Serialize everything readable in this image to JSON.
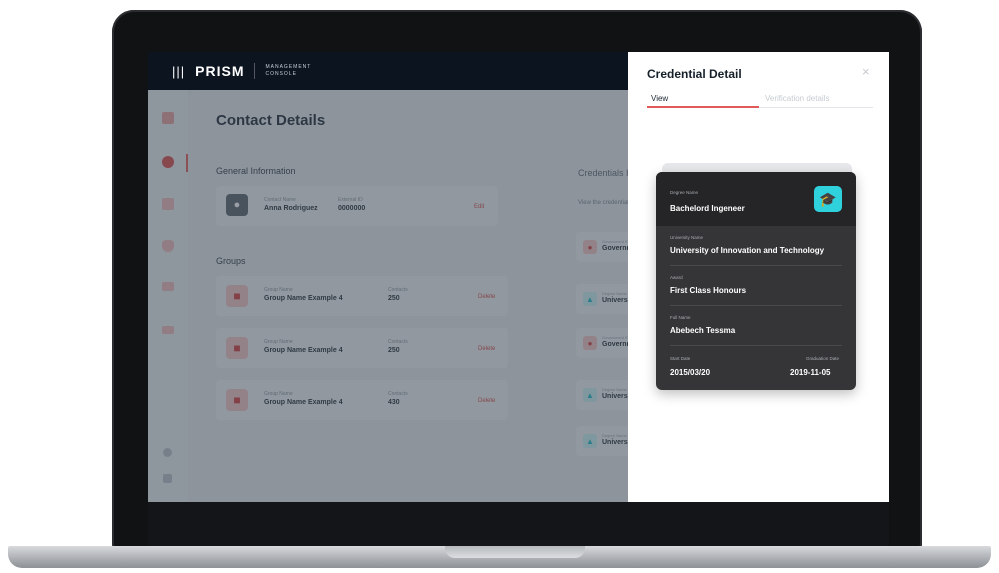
{
  "logo": {
    "mark": "|||",
    "name": "PRISM",
    "sub_line1": "MANAGEMENT",
    "sub_line2": "CONSOLE"
  },
  "page": {
    "title": "Contact Details"
  },
  "general": {
    "section": "General Information",
    "contact_name_label": "Contact Name",
    "contact_name": "Anna Rodriguez",
    "external_id_label": "External ID",
    "external_id": "0000000",
    "edit": "Edit"
  },
  "groups": {
    "section": "Groups",
    "group_name_label": "Group Name",
    "contacts_label": "Contacts",
    "delete": "Delete",
    "rows": [
      {
        "name": "Group Name Example 4",
        "contacts": "250"
      },
      {
        "name": "Group Name Example 4",
        "contacts": "250"
      },
      {
        "name": "Group Name Example 4",
        "contacts": "430"
      }
    ]
  },
  "credentials": {
    "section": "Credentials Issued (",
    "subtitle": "View the credentials tha",
    "items": [
      {
        "label": "Government ID",
        "value": "Government I",
        "kind": "gov"
      },
      {
        "label": "Degree Name",
        "value": "University of I",
        "kind": "uni"
      },
      {
        "label": "Government ID",
        "value": "Government I",
        "kind": "gov"
      },
      {
        "label": "Degree Name",
        "value": "University of I",
        "kind": "uni"
      },
      {
        "label": "Degree Name",
        "value": "University of I",
        "kind": "uni"
      }
    ]
  },
  "drawer": {
    "title": "Credential Detail",
    "close": "×",
    "tab_view": "View",
    "tab_verification": "Verification details"
  },
  "certificate": {
    "degree_label": "Degree Name",
    "degree": "Bachelord Ingeneer",
    "university_label": "University Name",
    "university": "University of Innovation and Technology",
    "award_label": "Award",
    "award": "First Class Honours",
    "fullname_label": "Full Name",
    "fullname": "Abebech Tessma",
    "start_label": "Start Date",
    "start": "2015/03/20",
    "grad_label": "Graduation Date",
    "grad": "2019-11-05"
  },
  "colors": {
    "accent": "#e05a5a",
    "teal": "#2ed1dc",
    "topbar": "#0c1420"
  }
}
